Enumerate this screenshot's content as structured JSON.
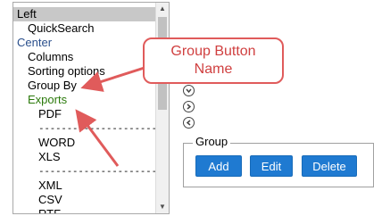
{
  "list": {
    "items": [
      {
        "label": "Left",
        "kind": "category-selected"
      },
      {
        "label": "QuickSearch",
        "kind": "l1"
      },
      {
        "label": "Center",
        "kind": "category"
      },
      {
        "label": "Columns",
        "kind": "l1"
      },
      {
        "label": "Sorting options",
        "kind": "l1"
      },
      {
        "label": "Group By",
        "kind": "l1"
      },
      {
        "label": "Exports",
        "kind": "l1-green"
      },
      {
        "label": "PDF",
        "kind": "l2"
      },
      {
        "label": "---------------------",
        "kind": "l2-sep"
      },
      {
        "label": "WORD",
        "kind": "l2"
      },
      {
        "label": "XLS",
        "kind": "l2"
      },
      {
        "label": "---------------------",
        "kind": "l2-sep"
      },
      {
        "label": "XML",
        "kind": "l2"
      },
      {
        "label": "CSV",
        "kind": "l2"
      },
      {
        "label": "RTF",
        "kind": "l2"
      }
    ]
  },
  "callout": {
    "line1": "Group Button",
    "line2": "Name"
  },
  "group": {
    "legend": "Group",
    "add_label": "Add",
    "edit_label": "Edit",
    "delete_label": "Delete"
  },
  "colors": {
    "button": "#1f7ad1",
    "callout": "#e05b5b",
    "arrow": "#e05b5b",
    "selected": "#c8c8c8"
  }
}
